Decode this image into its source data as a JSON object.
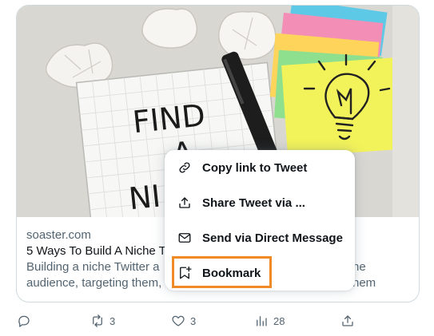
{
  "card": {
    "image_text": [
      "FIND",
      "A",
      "NI"
    ],
    "domain": "soaster.com",
    "title": "5 Ways To Build A Niche T",
    "description_line1": "Building a niche Twitter a",
    "description_line1_tail": "he",
    "description_line2": "audience, targeting them,",
    "description_line2_tail": "hem"
  },
  "menu": {
    "items": [
      {
        "label": "Copy link to Tweet",
        "icon": "link-icon"
      },
      {
        "label": "Share Tweet via ...",
        "icon": "share-icon"
      },
      {
        "label": "Send via Direct Message",
        "icon": "envelope-icon"
      },
      {
        "label": "Bookmark",
        "icon": "bookmark-add-icon"
      }
    ],
    "highlighted_item": "Bookmark",
    "highlight_color": "#f08a24"
  },
  "actions": {
    "reply_count": "",
    "retweet_count": "3",
    "like_count": "3",
    "views_count": "28"
  },
  "colors": {
    "text_primary": "#0f1419",
    "text_secondary": "#536471",
    "border": "#cfd9de"
  }
}
